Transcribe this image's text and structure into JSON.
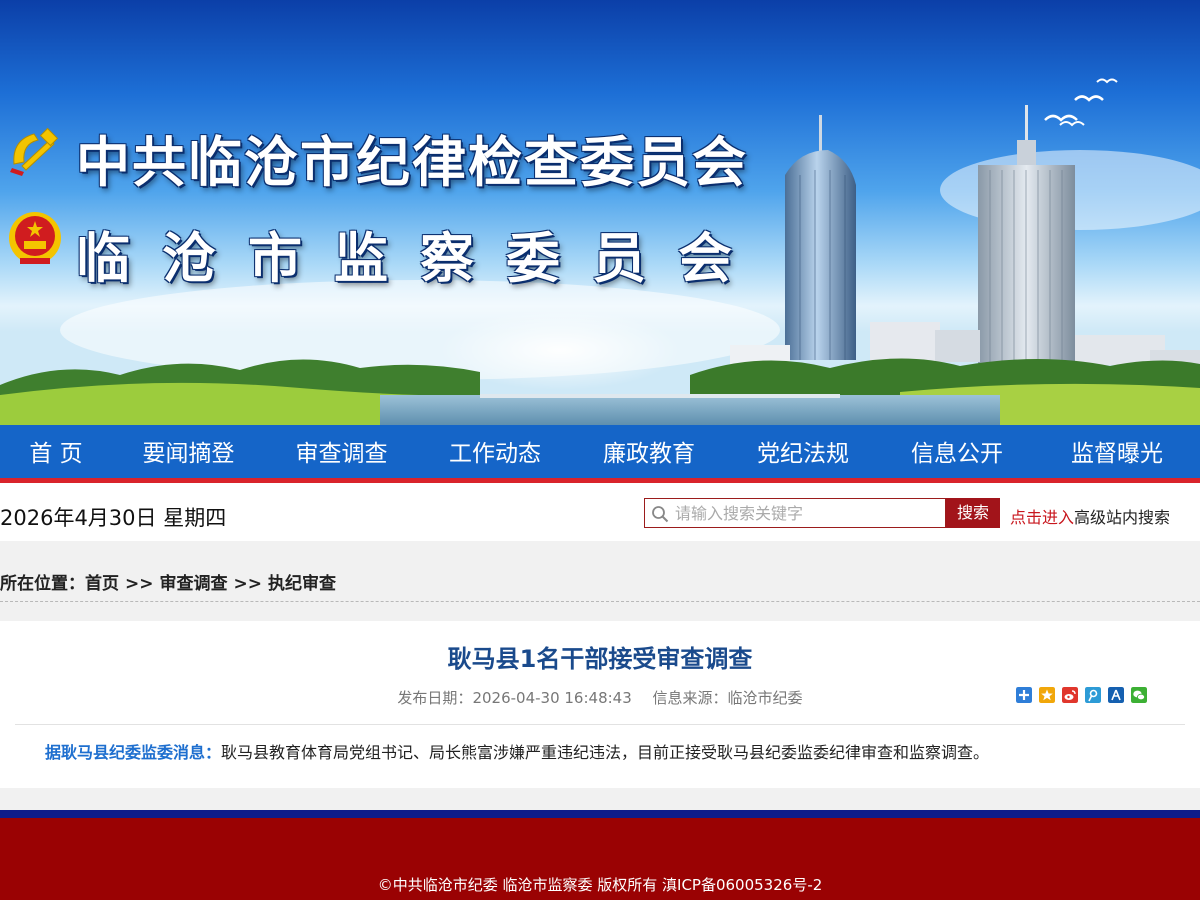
{
  "banner": {
    "title_line1": "中共临沧市纪律检查委员会",
    "title_line2": "临沧市监察委员会",
    "party_emblem_icon": "party-emblem-icon",
    "national_emblem_icon": "national-emblem-icon"
  },
  "nav": {
    "items": [
      {
        "label": "首 页"
      },
      {
        "label": "要闻摘登"
      },
      {
        "label": "审查调查"
      },
      {
        "label": "工作动态"
      },
      {
        "label": "廉政教育"
      },
      {
        "label": "党纪法规"
      },
      {
        "label": "信息公开"
      },
      {
        "label": "监督曝光"
      }
    ],
    "background_color": "#1565c8",
    "underline_color": "#d9232b"
  },
  "infobar": {
    "date": "2026年4月30日 星期四",
    "search_placeholder": "请输入搜索关键字",
    "search_button": "搜索",
    "advanced_link": "点击进入",
    "advanced_text": "高级站内搜索"
  },
  "breadcrumb": {
    "label": "所在位置：",
    "items": [
      "首页",
      "审查调查",
      "执纪审查"
    ],
    "separator": ">>"
  },
  "article": {
    "title": "耿马县1名干部接受审查调查",
    "publish_label": "发布日期：",
    "publish_date": "2026-04-30 16:48:43",
    "source_label": "信息来源：",
    "source": "临沧市纪委",
    "lead": "据耿马县纪委监委消息：",
    "body": "耿马县教育体育局党组书记、局长熊富涉嫌严重违纪违法，目前正接受耿马县纪委监委纪律审查和监察调查。",
    "share_icons": [
      "share-more-icon",
      "qzone-icon",
      "weibo-icon",
      "tencent-weibo-icon",
      "renren-icon",
      "wechat-icon"
    ]
  },
  "footer": {
    "copyright": "©中共临沧市纪委 临沧市监察委 版权所有 滇ICP备06005326号-2",
    "background_color": "#9a0203"
  }
}
